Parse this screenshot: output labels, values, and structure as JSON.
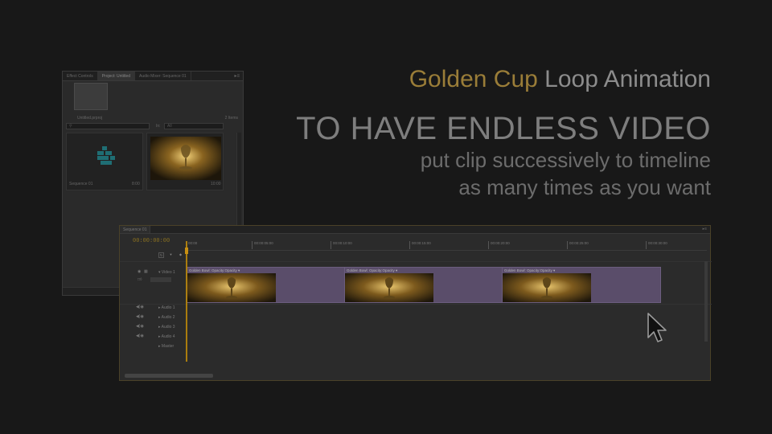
{
  "headline": {
    "title_gold": "Golden Cup",
    "title_rest": "Loop Animation",
    "main": "TO HAVE ENDLESS VIDEO",
    "sub1": "put clip successively to timeline",
    "sub2": "as many times as you want"
  },
  "project_panel": {
    "tabs": [
      "Effect Controls",
      "Project: Untitled",
      "Audio Mixer: Sequence 01"
    ],
    "menu_icon": "menu-arrow-icon",
    "project_name": "Untitled.prproj",
    "items_count": "2 Items",
    "search_placeholder": "",
    "in_label": "In:",
    "in_value": "All",
    "items": [
      {
        "name": "Sequence 01",
        "duration": "8:00"
      },
      {
        "name": "",
        "duration": "10:00"
      }
    ]
  },
  "timeline": {
    "tab": "Sequence 01",
    "timecode": "00:00:00:00",
    "ruler_labels": [
      "00:00",
      "00:00:05:00",
      "00:00:10:00",
      "00:00:15:00",
      "00:00:20:00",
      "00:00:25:00",
      "00:00:30:00"
    ],
    "tracks": [
      "Video 1",
      "Audio 1",
      "Audio 2",
      "Audio 3",
      "Audio 4",
      "Master"
    ],
    "clips": [
      {
        "title": "Golden Bowl: Opacity:Opacity ▾"
      },
      {
        "title": "Golden Bowl: Opacity:Opacity ▾"
      },
      {
        "title": "Golden Bowl: Opacity:Opacity ▾"
      }
    ]
  },
  "colors": {
    "gold": "#9a7d38",
    "clip": "#5a4d6a",
    "timecode": "#8a7020"
  }
}
